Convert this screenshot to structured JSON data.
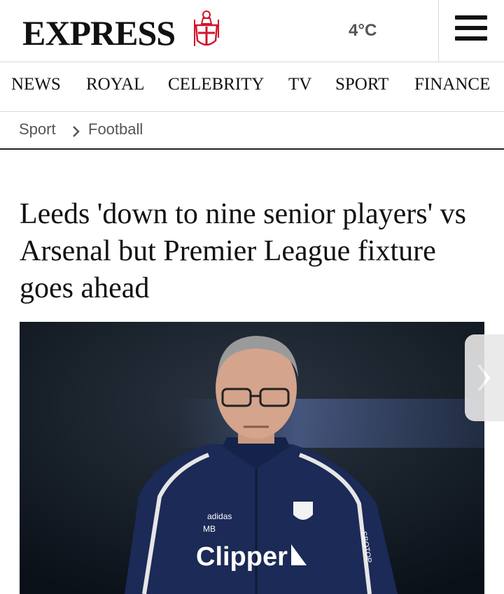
{
  "header": {
    "logo_text": "EXPRESS",
    "weather": "4°C"
  },
  "nav": {
    "items": [
      "NEWS",
      "ROYAL",
      "CELEBRITY",
      "TV",
      "SPORT",
      "FINANCE"
    ]
  },
  "breadcrumb": {
    "section": "Sport",
    "subsection": "Football"
  },
  "article": {
    "headline": "Leeds 'down to nine senior players' vs Arsenal but Premier League fixture goes ahead",
    "image": {
      "brand_sponsor": "Clipper",
      "kit_maker": "adidas",
      "initials": "MB",
      "sleeve_text": "SBOTOP"
    }
  },
  "colors": {
    "brand_red": "#d2142a",
    "kit_navy": "#1b2a56"
  },
  "icons": {
    "menu": "hamburger-icon",
    "crest": "crusader-crest-icon",
    "breadcrumb_sep": "chevron-right-icon",
    "carousel_next": "chevron-right-icon"
  }
}
